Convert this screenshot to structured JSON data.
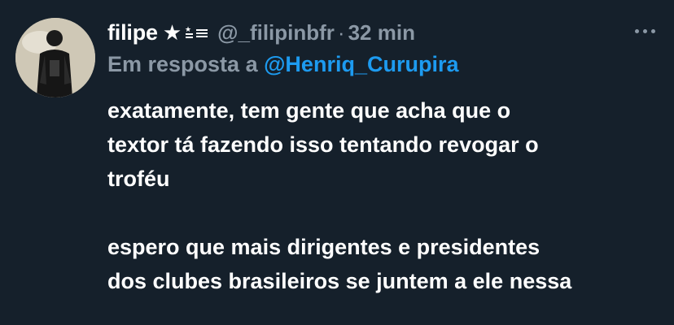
{
  "tweet": {
    "author": {
      "display_name": "filipe",
      "badge_star": "★",
      "flag_icon": "brazil-style-flag-icon",
      "handle": "@_filipinbfr",
      "separator": "·",
      "time": "32 min"
    },
    "reply": {
      "prefix": "Em resposta a",
      "handle": "@Henriq_Curupira"
    },
    "paragraphs": [
      {
        "lines": [
          "exatamente, tem gente que acha que o",
          "textor tá fazendo isso tentando revogar o",
          "troféu"
        ]
      },
      {
        "lines": [
          "espero que mais dirigentes e presidentes",
          "dos clubes brasileiros se juntem a ele nessa"
        ]
      }
    ]
  },
  "colors": {
    "background": "#15202b",
    "primary_text": "#ffffff",
    "secondary_text": "#8b98a5",
    "link": "#1d9bf0"
  }
}
